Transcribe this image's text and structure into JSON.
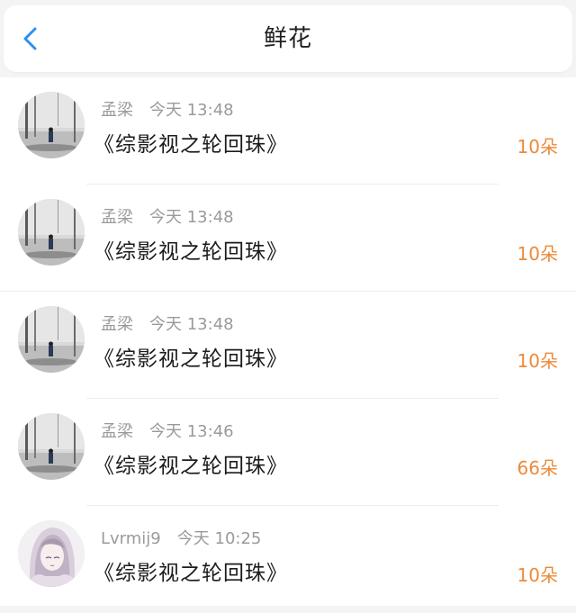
{
  "header": {
    "title": "鲜花",
    "back_icon": "chevron-left-icon",
    "accent_color": "#2f8ff0"
  },
  "list": {
    "count_color": "#ec8a3a",
    "items": [
      {
        "username": "孟梁",
        "time": "今天 13:48",
        "book": "《综影视之轮回珠》",
        "count": "10朵",
        "avatar": "landscape-avatar"
      },
      {
        "username": "孟梁",
        "time": "今天 13:48",
        "book": "《综影视之轮回珠》",
        "count": "10朵",
        "avatar": "landscape-avatar"
      },
      {
        "username": "孟梁",
        "time": "今天 13:48",
        "book": "《综影视之轮回珠》",
        "count": "10朵",
        "avatar": "landscape-avatar"
      },
      {
        "username": "孟梁",
        "time": "今天 13:46",
        "book": "《综影视之轮回珠》",
        "count": "66朵",
        "avatar": "landscape-avatar"
      },
      {
        "username": "Lvrmij9",
        "time": "今天 10:25",
        "book": "《综影视之轮回珠》",
        "count": "10朵",
        "avatar": "anime-girl-avatar"
      }
    ]
  }
}
